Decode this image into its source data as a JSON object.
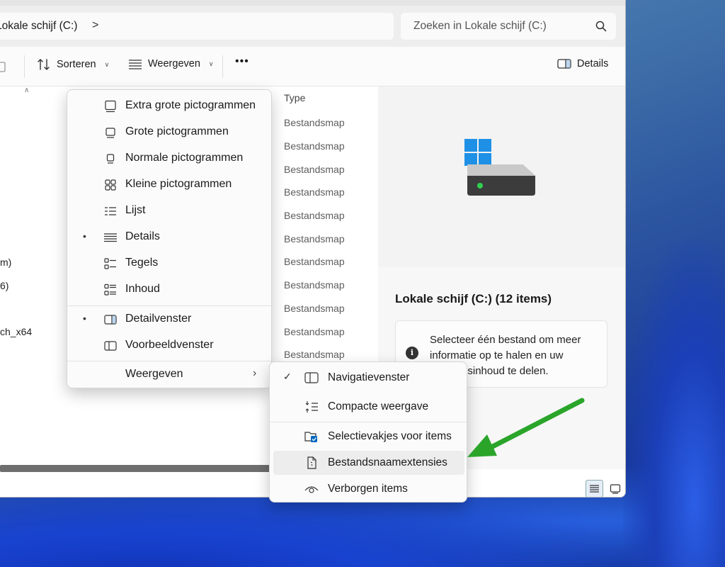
{
  "address": {
    "path": "Lokale schijf (C:)",
    "chevron": ">"
  },
  "search": {
    "placeholder": "Zoeken in Lokale schijf (C:)"
  },
  "toolbar": {
    "sort_label": "Sorteren",
    "view_label": "Weergeven",
    "more_label": "•••",
    "details_label": "Details"
  },
  "list": {
    "type_header": "Type",
    "rows": [
      "Bestandsmap",
      "Bestandsmap",
      "Bestandsmap",
      "Bestandsmap",
      "Bestandsmap",
      "Bestandsmap",
      "Bestandsmap",
      "Bestandsmap",
      "Bestandsmap",
      "Bestandsmap",
      "Bestandsmap"
    ],
    "name_fragments": [
      "m)",
      "6)",
      "ch_x64"
    ]
  },
  "view_menu": {
    "items": [
      {
        "label": "Extra grote pictogrammen",
        "icon": "extra-large-icons-icon",
        "selected": false
      },
      {
        "label": "Grote pictogrammen",
        "icon": "large-icons-icon",
        "selected": false
      },
      {
        "label": "Normale pictogrammen",
        "icon": "medium-icons-icon",
        "selected": false
      },
      {
        "label": "Kleine pictogrammen",
        "icon": "small-icons-icon",
        "selected": false
      },
      {
        "label": "Lijst",
        "icon": "list-icon",
        "selected": false
      },
      {
        "label": "Details",
        "icon": "details-icon",
        "selected": true
      },
      {
        "label": "Tegels",
        "icon": "tiles-icon",
        "selected": false
      },
      {
        "label": "Inhoud",
        "icon": "content-icon",
        "selected": false
      },
      {
        "label": "Detailvenster",
        "icon": "details-pane-icon",
        "selected": true
      },
      {
        "label": "Voorbeeldvenster",
        "icon": "preview-pane-icon",
        "selected": false
      },
      {
        "label": "Weergeven",
        "icon": "",
        "selected": false
      }
    ],
    "bullet": "•",
    "submenu_arrow": "›"
  },
  "show_submenu": {
    "items": [
      {
        "label": "Navigatievenster",
        "icon": "navigation-pane-icon",
        "checked": true
      },
      {
        "label": "Compacte weergave",
        "icon": "compact-view-icon",
        "checked": false
      },
      {
        "label": "Selectievakjes voor items",
        "icon": "item-checkboxes-icon",
        "checked": false
      },
      {
        "label": "Bestandsnaamextensies",
        "icon": "file-extensions-icon",
        "checked": false
      },
      {
        "label": "Verborgen items",
        "icon": "hidden-items-icon",
        "checked": false
      }
    ],
    "check": "✓"
  },
  "details_pane": {
    "title": "Lokale schijf (C:) (12 items)",
    "info_icon": "i",
    "info_text": "Selecteer één bestand om meer informatie op te halen en uw bestandsinhoud te delen."
  },
  "colors": {
    "accent": "#0067c0",
    "arrow": "#2aa52a",
    "win_blue": "#1e90e6"
  }
}
